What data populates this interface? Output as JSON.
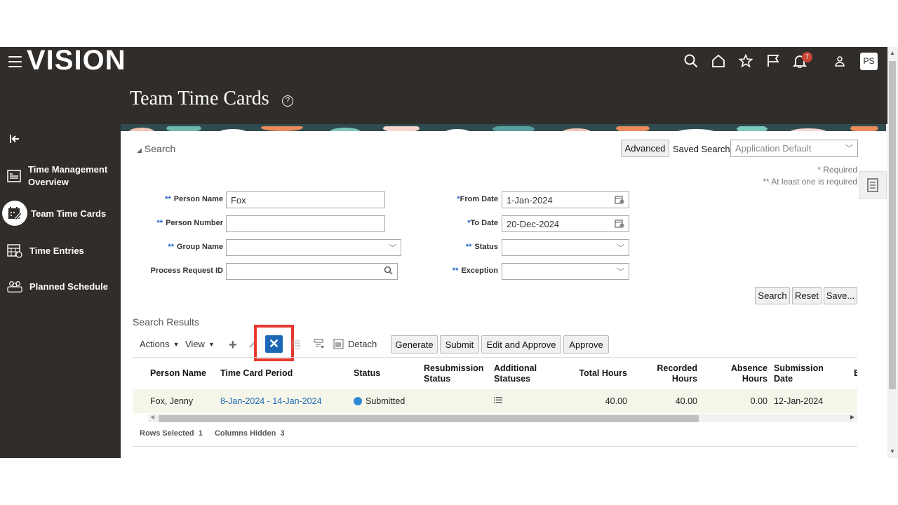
{
  "app": {
    "logo": "VISION",
    "title": "Team Time Cards",
    "avatar_initials": "PS",
    "notification_count": "7"
  },
  "colors": {
    "topbar_bg": "#312d2a",
    "accent_blue": "#1d68b5",
    "highlight_red": "#e8392f",
    "row_bg": "#f5f6e9"
  },
  "nav": {
    "items": [
      {
        "label": "Time Management Overview",
        "icon": "dashboard-icon"
      },
      {
        "label": "Team Time Cards",
        "icon": "calendar-edit-icon",
        "active": true
      },
      {
        "label": "Time Entries",
        "icon": "calendar-grid-icon"
      },
      {
        "label": "Planned Schedule",
        "icon": "team-icon"
      }
    ]
  },
  "search": {
    "toggle_label": "Search",
    "advanced_label": "Advanced",
    "saved_search_label": "Saved Search",
    "saved_search_value": "Application Default",
    "required_note": "* Required",
    "one_required_note": "** At least one is required",
    "req_single": "*",
    "req_double": "**",
    "fields": {
      "person_name": {
        "label": "Person Name",
        "value": "Fox"
      },
      "person_number": {
        "label": "Person Number",
        "value": ""
      },
      "group_name": {
        "label": "Group Name",
        "value": ""
      },
      "process_request_id": {
        "label": "Process Request ID",
        "value": ""
      },
      "from_date": {
        "label": "From Date",
        "value": "1-Jan-2024"
      },
      "to_date": {
        "label": "To Date",
        "value": "20-Dec-2024"
      },
      "status": {
        "label": "Status",
        "value": ""
      },
      "exception": {
        "label": "Exception",
        "value": ""
      }
    },
    "buttons": {
      "search": "Search",
      "reset": "Reset",
      "save": "Save..."
    }
  },
  "results": {
    "title": "Search Results",
    "actions_label": "Actions",
    "view_label": "View",
    "detach_label": "Detach",
    "buttons": {
      "generate": "Generate",
      "submit": "Submit",
      "edit_approve": "Edit and Approve",
      "approve": "Approve"
    },
    "columns": {
      "person_name": "Person Name",
      "period": "Time Card Period",
      "status": "Status",
      "resub_1": "Resubmission",
      "resub_2": "Status",
      "addl_1": "Additional",
      "addl_2": "Statuses",
      "total_hours": "Total Hours",
      "recorded_1": "Recorded",
      "recorded_2": "Hours",
      "absence_1": "Absence",
      "absence_2": "Hours",
      "submission_1": "Submission",
      "submission_2": "Date",
      "extra": "E"
    },
    "row": {
      "person_name": "Fox, Jenny",
      "period": "8-Jan-2024 - 14-Jan-2024",
      "status": "Submitted",
      "total_hours": "40.00",
      "recorded_hours": "40.00",
      "absence_hours": "0.00",
      "submission_date": "12-Jan-2024"
    },
    "footer": {
      "rows_selected_label": "Rows Selected",
      "rows_selected": "1",
      "columns_hidden_label": "Columns Hidden",
      "columns_hidden": "3"
    }
  }
}
